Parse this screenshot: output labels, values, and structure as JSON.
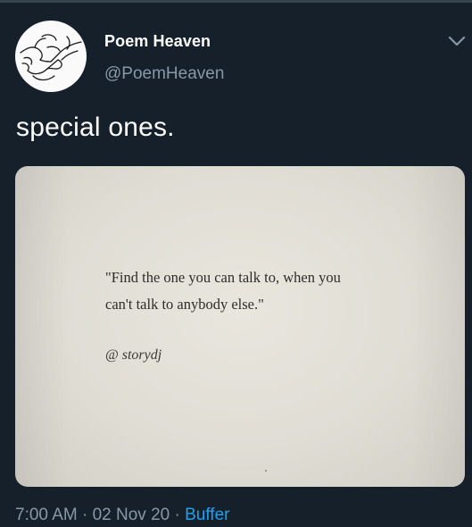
{
  "tweet": {
    "display_name": "Poem Heaven",
    "handle": "@PoemHeaven",
    "text": "special ones.",
    "time": "7:00 AM",
    "separator": "·",
    "date": "02 Nov 20",
    "source": "Buffer"
  },
  "media": {
    "quote_line_1": "\"Find the one you can talk to, when you",
    "quote_line_2": "can't talk to anybody else.\"",
    "attribution": "@ storydj"
  },
  "icons": {
    "avatar": "hands-holding-avatar",
    "menu": "chevron-down-icon"
  },
  "colors": {
    "background": "#15202b",
    "primary_text": "#ffffff",
    "secondary_text": "#8899a6",
    "link": "#1da1f2",
    "divider": "#38444d"
  }
}
